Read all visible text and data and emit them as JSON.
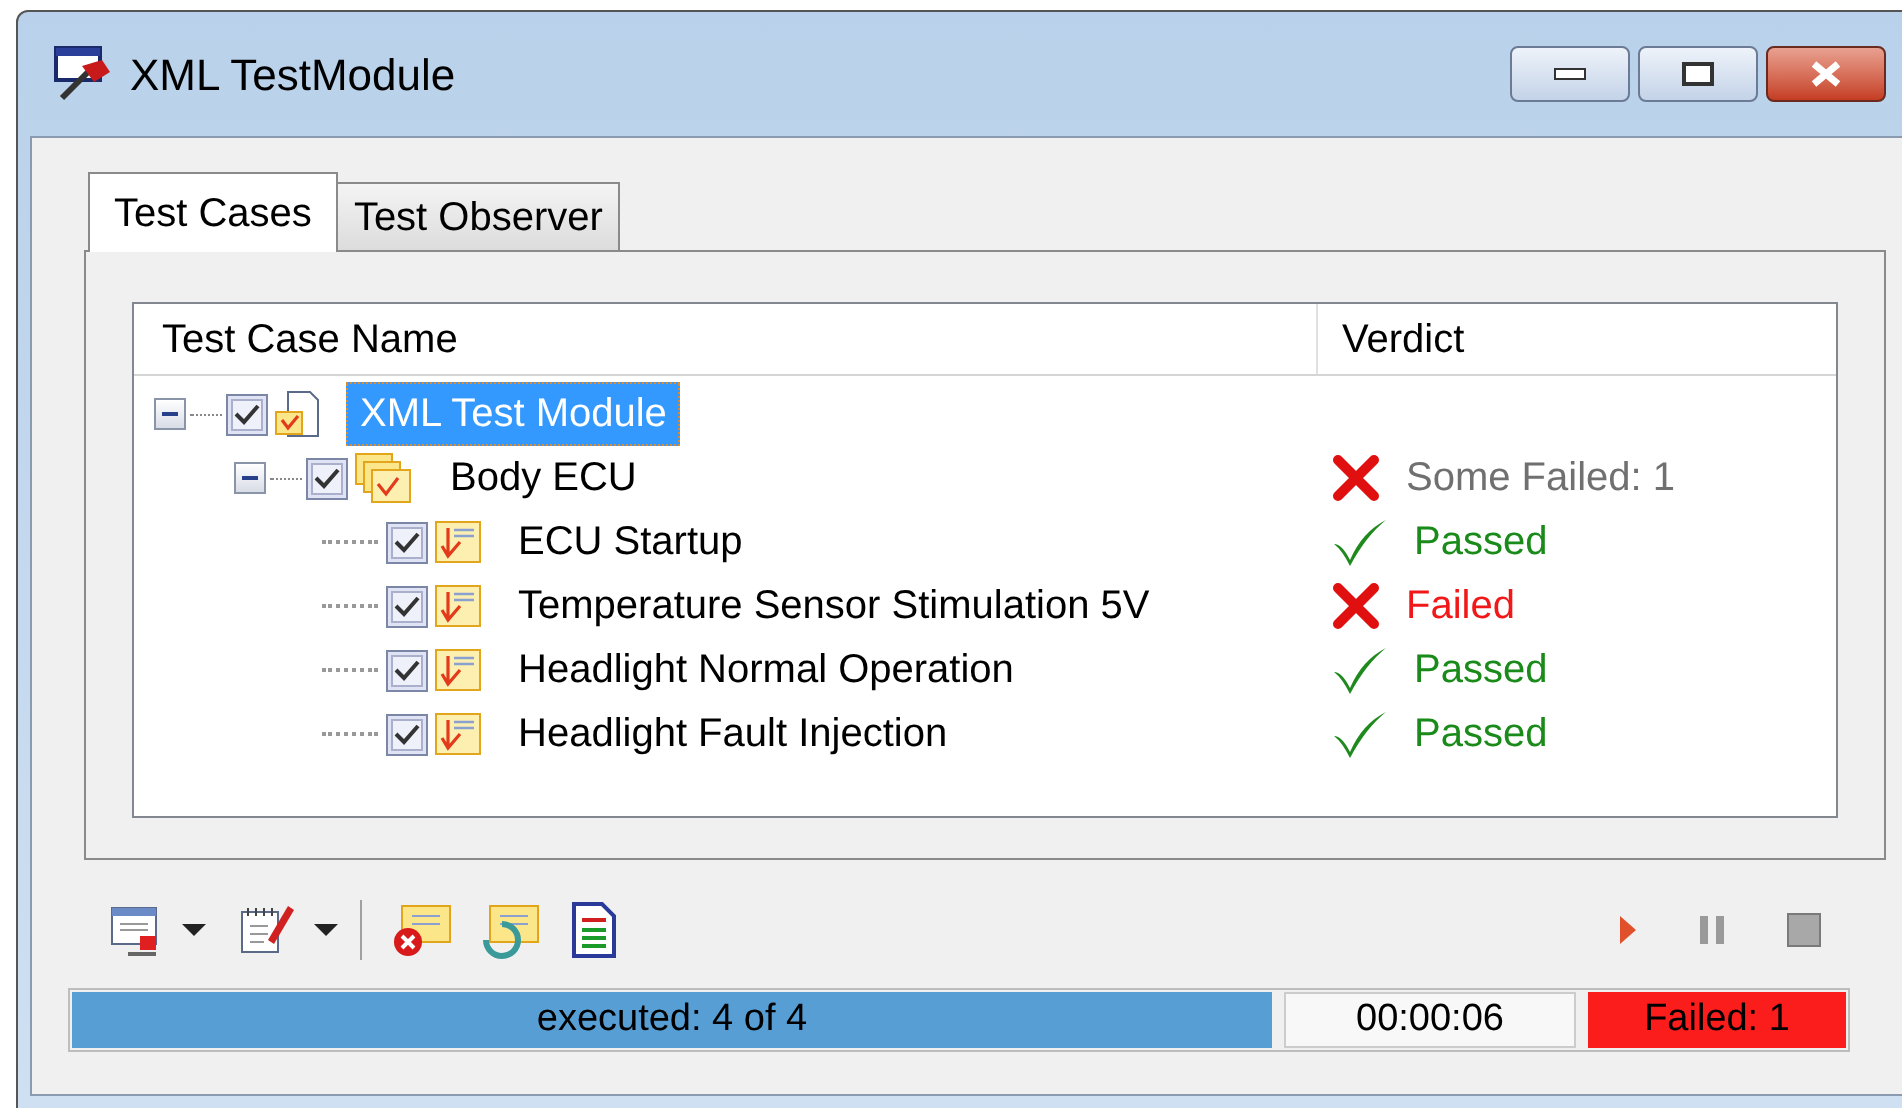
{
  "window": {
    "title": "XML TestModule"
  },
  "tabs": [
    {
      "label": "Test Cases",
      "selected": true
    },
    {
      "label": "Test Observer",
      "selected": false
    }
  ],
  "table": {
    "columns": [
      "Test Case Name",
      "Verdict"
    ],
    "tree": [
      {
        "name": "XML Test Module",
        "kind": "module",
        "checked": true,
        "selected": true,
        "expanded": true,
        "children": [
          {
            "name": "Body ECU",
            "kind": "group",
            "checked": true,
            "selected": false,
            "expanded": true,
            "verdict": {
              "text": "Some Failed: 1",
              "kind": "some_failed"
            },
            "children": [
              {
                "name": "ECU Startup",
                "kind": "case",
                "checked": true,
                "selected": false,
                "verdict": {
                  "text": "Passed",
                  "kind": "passed"
                }
              },
              {
                "name": "Temperature Sensor Stimulation 5V",
                "kind": "case",
                "checked": true,
                "selected": false,
                "verdict": {
                  "text": "Failed",
                  "kind": "failed"
                }
              },
              {
                "name": "Headlight Normal Operation",
                "kind": "case",
                "checked": true,
                "selected": false,
                "verdict": {
                  "text": "Passed",
                  "kind": "passed"
                }
              },
              {
                "name": "Headlight Fault Injection",
                "kind": "case",
                "checked": true,
                "selected": false,
                "verdict": {
                  "text": "Passed",
                  "kind": "passed"
                }
              }
            ]
          }
        ]
      }
    ]
  },
  "status_bar": {
    "progress": {
      "label": "executed: 4 of 4",
      "level": 1
    },
    "time": "00:00:06",
    "result": {
      "text": "Failed: 1",
      "kind": "failed"
    }
  }
}
